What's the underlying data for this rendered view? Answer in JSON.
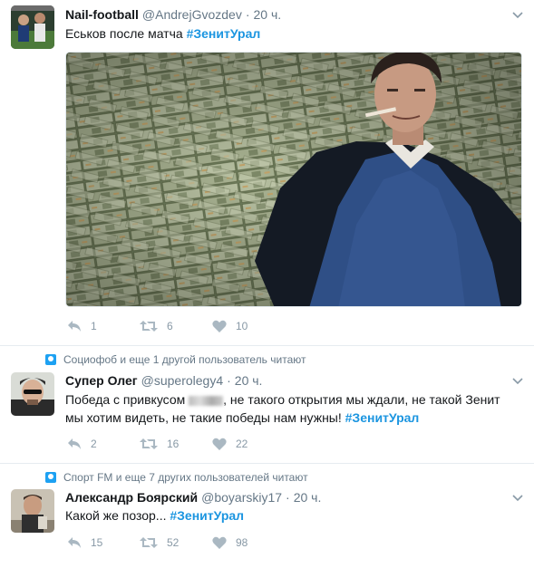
{
  "tweets": [
    {
      "fullname": "Nail-football",
      "username": "@AndrejGvozdev",
      "dot": "·",
      "time": "20 ч.",
      "text": "Еськов после матча",
      "hashtag": "#ЗенитУрал",
      "replies": "1",
      "retweets": "6",
      "likes": "10"
    },
    {
      "context": "Социофоб и еще 1 другой пользователь читают",
      "fullname": "Супер Олег",
      "username": "@superolegy4",
      "dot": "·",
      "time": "20 ч.",
      "text_pre": "Победа с привкусом ",
      "text_post": ", не такого открытия мы ждали, не такой Зенит мы хотим видеть, не такие победы нам нужны! ",
      "hashtag": "#ЗенитУрал",
      "replies": "2",
      "retweets": "16",
      "likes": "22"
    },
    {
      "context": "Спорт FM и еще 7 других пользователей читают",
      "fullname": "Александр Боярский",
      "username": "@boyarskiy17",
      "dot": "·",
      "time": "20 ч.",
      "text": "Какой же позор... ",
      "hashtag": "#ЗенитУрал",
      "replies": "15",
      "retweets": "52",
      "likes": "98"
    }
  ],
  "colors": {
    "accent": "#1b95e0",
    "secondary_text": "#657786",
    "action_gray": "#8899a6"
  },
  "icons": [
    "reply-icon",
    "retweet-icon",
    "like-icon",
    "chevron-down-icon",
    "follow-context-icon"
  ]
}
